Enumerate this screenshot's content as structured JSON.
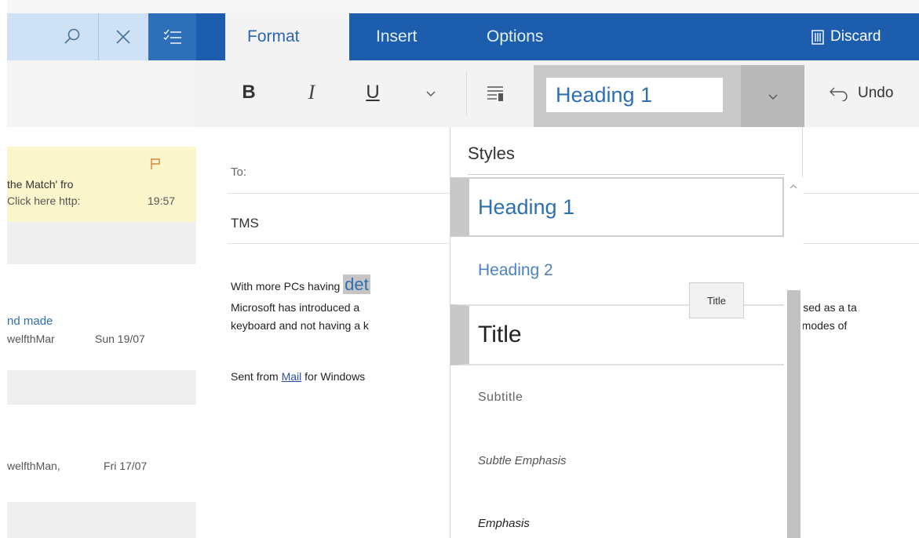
{
  "header": {
    "tabs": [
      {
        "label": "Format",
        "active": true
      },
      {
        "label": "Insert",
        "active": false
      },
      {
        "label": "Options",
        "active": false
      }
    ],
    "discard_label": "Discard"
  },
  "left_header": {
    "search_icon": "search-icon",
    "close_icon": "close-icon",
    "select_icon": "select-all-icon"
  },
  "toolbar": {
    "bold": "B",
    "italic": "I",
    "underline": "U",
    "style_value": "Heading 1",
    "undo_label": "Undo"
  },
  "mail_list": [
    {
      "line1": "the Match' fro",
      "line2": "Click here http:",
      "time": "19:57",
      "flagged": true,
      "highlighted": true
    },
    {
      "line1": "nd made",
      "line2": "welfthMar",
      "time": "Sun 19/07",
      "flagged": false,
      "highlighted": false
    },
    {
      "line1": "welfthMan,",
      "time": "Fri 17/07",
      "flagged": false,
      "highlighted": false
    }
  ],
  "compose": {
    "to_label": "To:",
    "subject": "TMS",
    "body_line1_start": "With more PCs having ",
    "body_line1_highlight": "det",
    "body_line2": "Microsoft has introduced a",
    "body_line3": "keyboard and not having a k",
    "body_right1": "be used as a ta",
    "body_right2": "two modes of",
    "signature_prefix": "Sent from ",
    "signature_link": "Mail",
    "signature_suffix": " for Windows"
  },
  "styles_menu": {
    "title": "Styles",
    "items": [
      "Heading 1",
      "Heading 2",
      "Title",
      "Subtitle",
      "Subtle Emphasis",
      "Emphasis"
    ],
    "selected": "Heading 1",
    "tooltip": "Title"
  },
  "colors": {
    "ribbon": "#1c5dae",
    "accent_text": "#2e6fb0",
    "flag_highlight": "#fcf6cc"
  }
}
